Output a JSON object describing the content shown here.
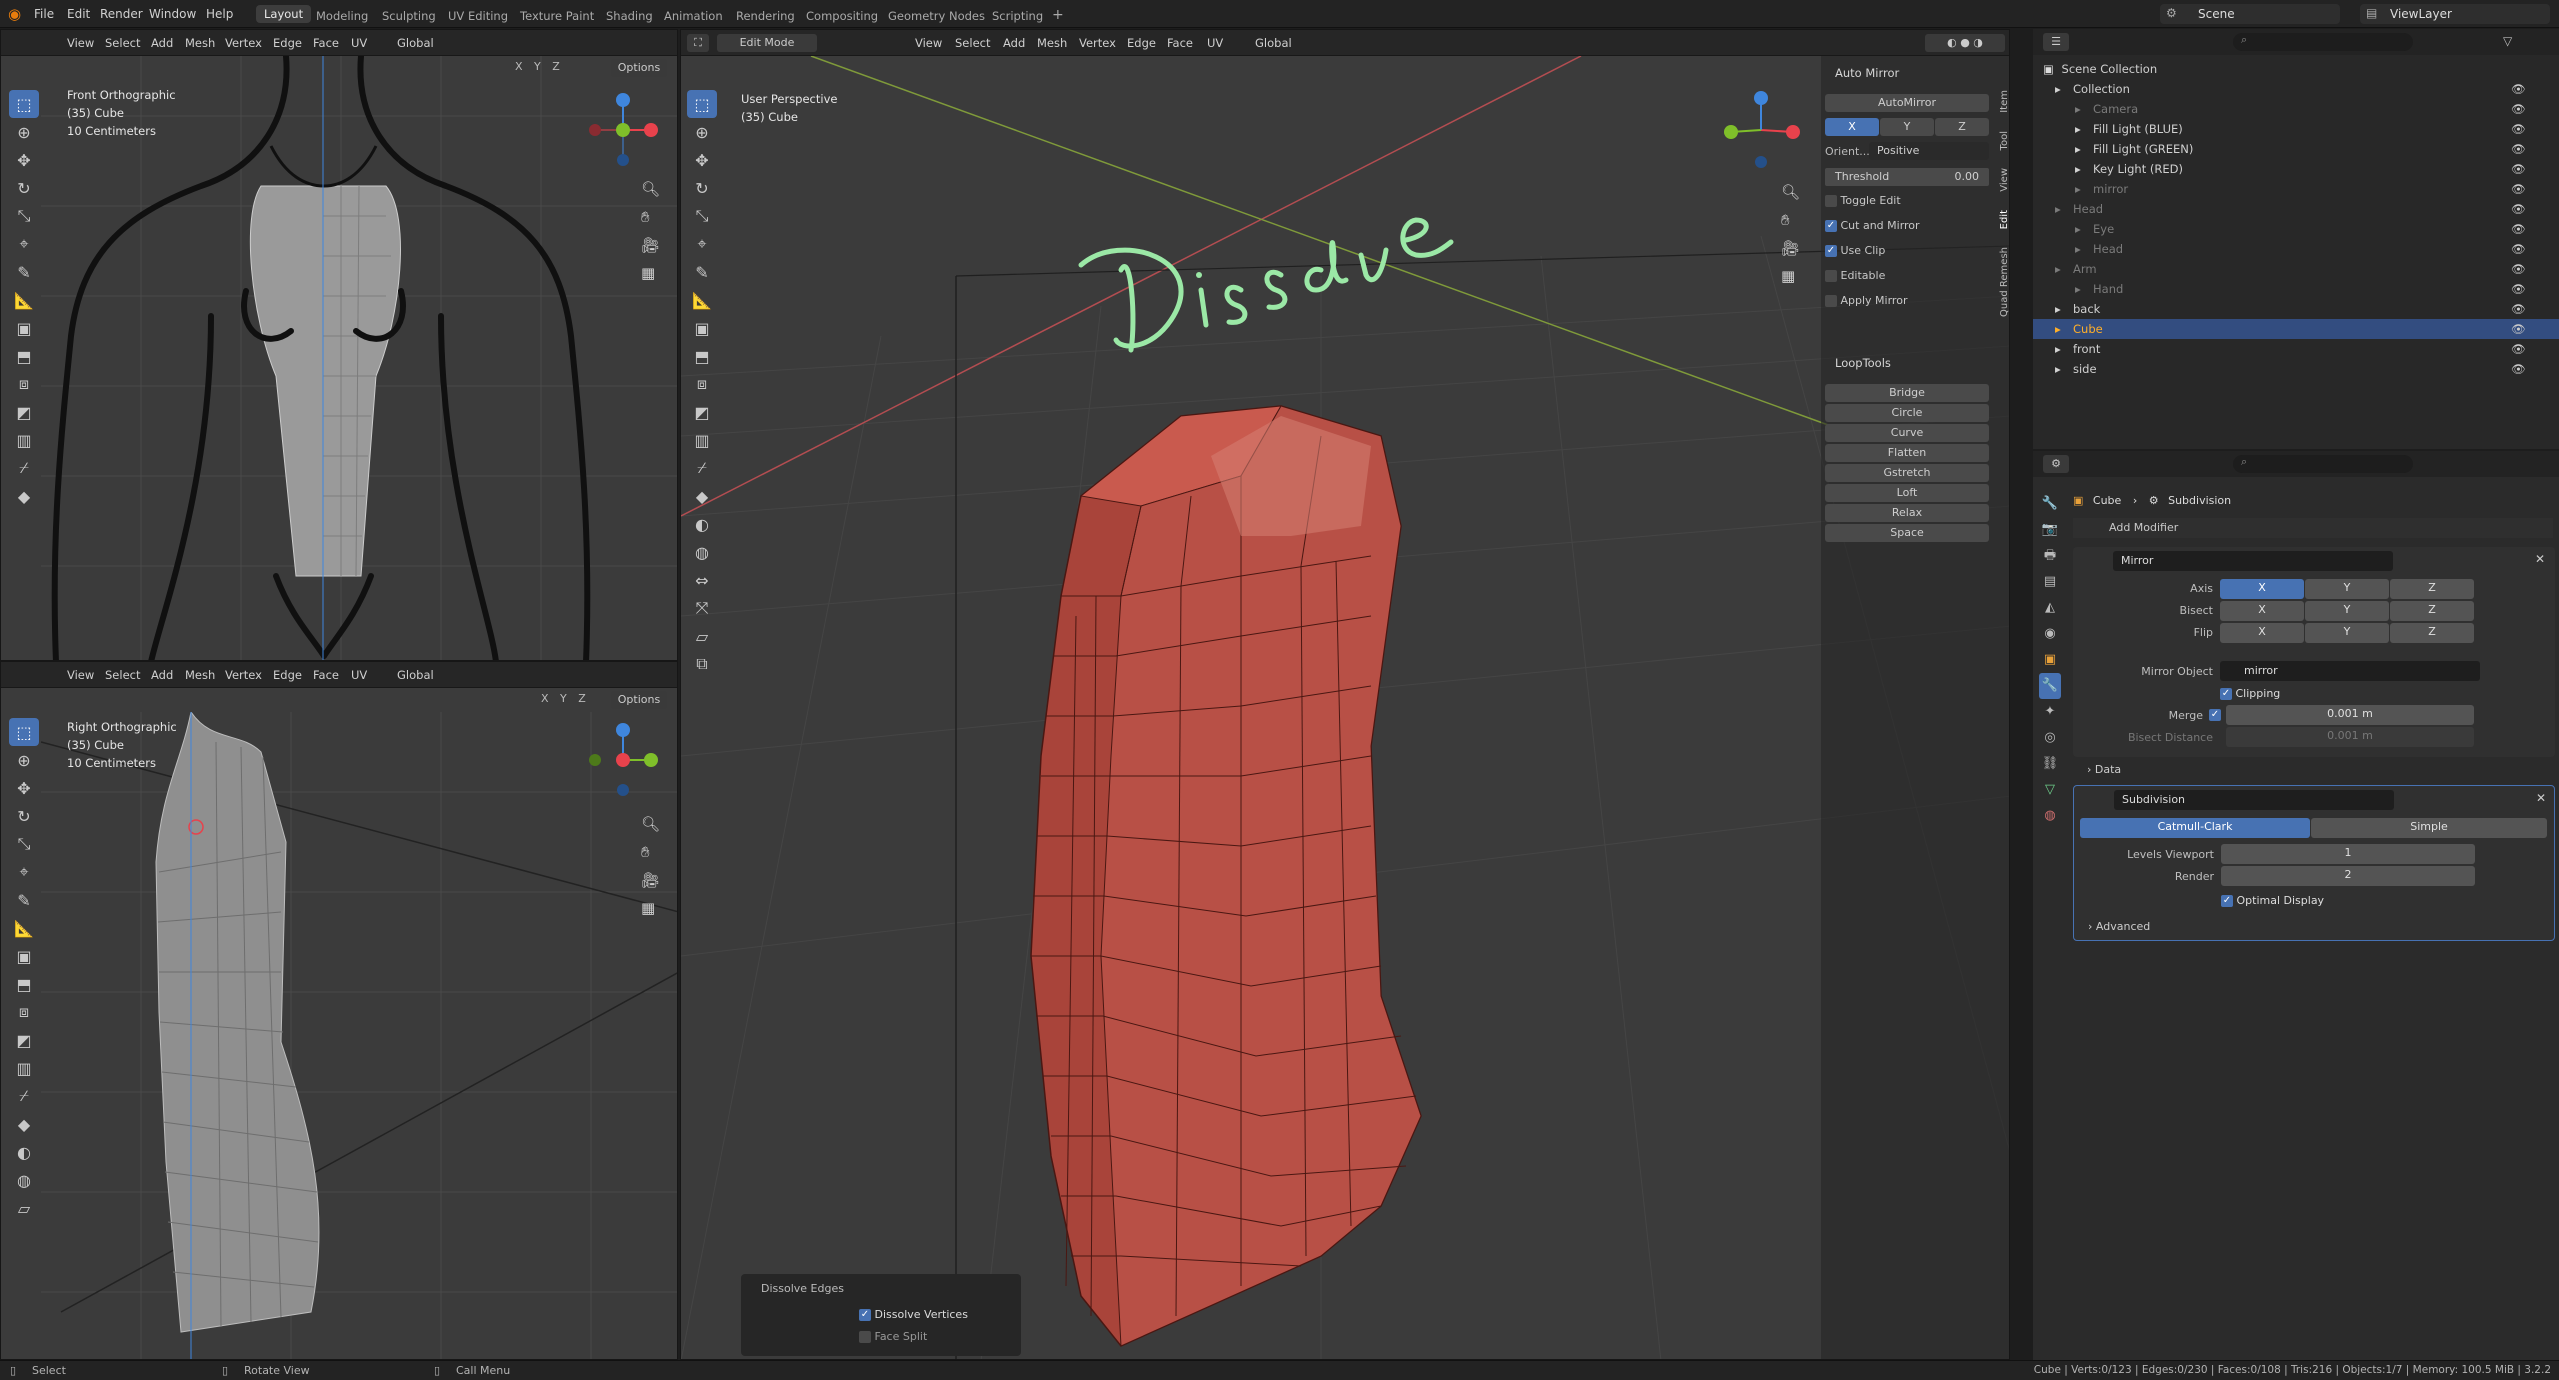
{
  "app": {
    "menus": [
      "File",
      "Edit",
      "Render",
      "Window",
      "Help"
    ],
    "workspaces": [
      "Layout",
      "Modeling",
      "Sculpting",
      "UV Editing",
      "Texture Paint",
      "Shading",
      "Animation",
      "Rendering",
      "Compositing",
      "Geometry Nodes",
      "Scripting"
    ],
    "add_tab": "+",
    "scene": "Scene",
    "view_layer": "ViewLayer"
  },
  "viewport_menus": [
    "View",
    "Select",
    "Add",
    "Mesh",
    "Vertex",
    "Edge",
    "Face",
    "UV"
  ],
  "transform_orientation": "Global",
  "axes": [
    "X",
    "Y",
    "Z"
  ],
  "options_label": "Options",
  "edit_mode_label": "Edit Mode",
  "front_vp": {
    "view": "Front Orthographic",
    "object": "(35) Cube",
    "scale": "10 Centimeters"
  },
  "right_vp": {
    "view": "Right Orthographic",
    "object": "(35) Cube",
    "scale": "10 Centimeters"
  },
  "persp_vp": {
    "view": "User Perspective",
    "object": "(35) Cube",
    "annotation": "Dissolve"
  },
  "sidebar_tabs": [
    "Item",
    "Tool",
    "View",
    "Edit",
    "Quad Remesh"
  ],
  "auto_mirror": {
    "title": "Auto Mirror",
    "button": "AutoMirror",
    "axes": [
      "X",
      "Y",
      "Z"
    ],
    "orient_label": "Orient...",
    "orient_value": "Positive",
    "threshold_label": "Threshold",
    "threshold_value": "0.00",
    "checks": [
      {
        "label": "Toggle Edit",
        "on": false
      },
      {
        "label": "Cut and Mirror",
        "on": true
      },
      {
        "label": "Use Clip",
        "on": true
      },
      {
        "label": "Editable",
        "on": false
      },
      {
        "label": "Apply Mirror",
        "on": false
      }
    ]
  },
  "looptools": {
    "title": "LoopTools",
    "items": [
      "Bridge",
      "Circle",
      "Curve",
      "Flatten",
      "Gstretch",
      "Loft",
      "Relax",
      "Space"
    ]
  },
  "dissolve_panel": {
    "title": "Dissolve Edges",
    "options": [
      {
        "label": "Dissolve Vertices",
        "on": true
      },
      {
        "label": "Face Split",
        "on": false
      }
    ]
  },
  "outliner": {
    "root": "Scene Collection",
    "rows": [
      {
        "label": "Collection",
        "level": 0,
        "color": "#d0d0d0"
      },
      {
        "label": "Camera",
        "level": 1,
        "color": "#7a7a7a"
      },
      {
        "label": "Fill Light (BLUE)",
        "level": 1,
        "color": "#d0d0d0"
      },
      {
        "label": "Fill Light (GREEN)",
        "level": 1,
        "color": "#d0d0d0"
      },
      {
        "label": "Key Light (RED)",
        "level": 1,
        "color": "#d0d0d0"
      },
      {
        "label": "mirror",
        "level": 1,
        "color": "#7a7a7a"
      },
      {
        "label": "Head",
        "level": 0,
        "color": "#7a7a7a"
      },
      {
        "label": "Eye",
        "level": 1,
        "color": "#7a7a7a"
      },
      {
        "label": "Head",
        "level": 1,
        "color": "#7a7a7a"
      },
      {
        "label": "Arm",
        "level": 0,
        "color": "#7a7a7a"
      },
      {
        "label": "Hand",
        "level": 1,
        "color": "#7a7a7a"
      },
      {
        "label": "back",
        "level": 0,
        "color": "#d0d0d0"
      },
      {
        "label": "Cube",
        "level": 0,
        "color": "#ffaf29",
        "selected": true
      },
      {
        "label": "front",
        "level": 0,
        "color": "#d0d0d0"
      },
      {
        "label": "side",
        "level": 0,
        "color": "#d0d0d0"
      }
    ]
  },
  "properties": {
    "breadcrumb_object": "Cube",
    "breadcrumb_modifier": "Subdivision",
    "add_modifier": "Add Modifier",
    "mirror": {
      "name": "Mirror",
      "axis_label": "Axis",
      "bisect_label": "Bisect",
      "flip_label": "Flip",
      "mirror_object_label": "Mirror Object",
      "mirror_object": "mirror",
      "clipping_label": "Clipping",
      "merge_label": "Merge",
      "merge_value": "0.001 m",
      "bisect_distance_label": "Bisect Distance",
      "bisect_distance_value": "0.001 m",
      "data_label": "Data"
    },
    "subdivision": {
      "name": "Subdivision",
      "catmull": "Catmull-Clark",
      "simple": "Simple",
      "levels_label": "Levels Viewport",
      "levels_value": "1",
      "render_label": "Render",
      "render_value": "2",
      "optimal_label": "Optimal Display",
      "advanced_label": "Advanced"
    }
  },
  "status": {
    "select": "Select",
    "rotate": "Rotate View",
    "call_menu": "Call Menu",
    "stats": "Cube | Verts:0/123 | Edges:0/230 | Faces:0/108 | Tris:216 | Objects:1/7 | Memory: 100.5 MiB | 3.2.2"
  },
  "colors": {
    "accent": "#4772b3",
    "mesh": "#b5493d",
    "annotation": "#9be8a6",
    "axis_x": "#e8424c",
    "axis_y": "#7fbf2a",
    "axis_z": "#3f86dd",
    "selected_object": "#ffaf29"
  }
}
